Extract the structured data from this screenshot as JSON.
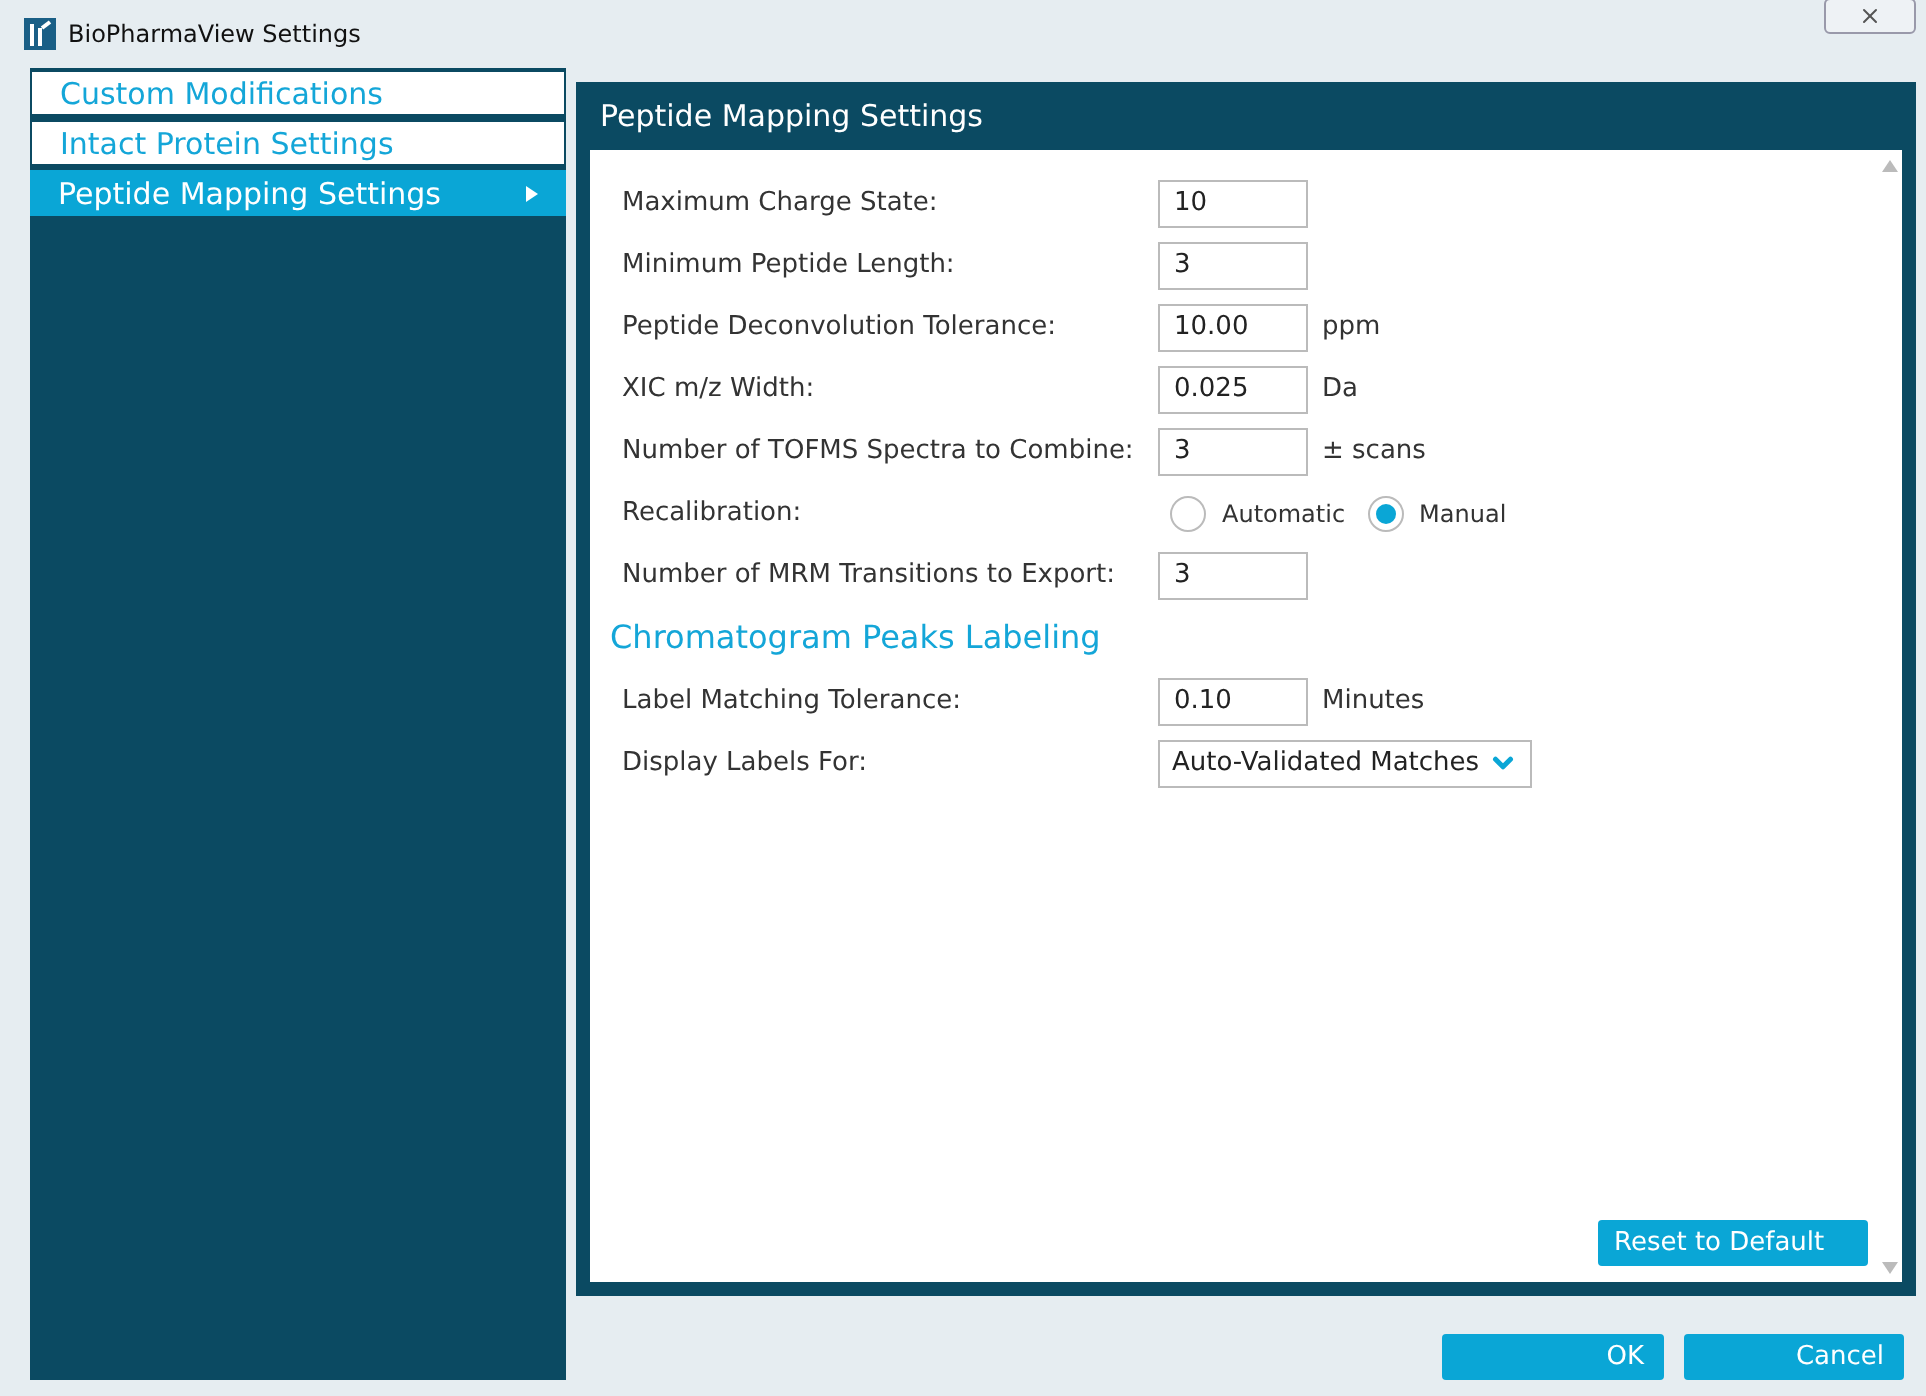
{
  "window": {
    "title": "BioPharmaView Settings"
  },
  "sidebar": {
    "items": [
      {
        "label": "Custom Modifications",
        "selected": false
      },
      {
        "label": "Intact Protein Settings",
        "selected": false
      },
      {
        "label": "Peptide Mapping Settings",
        "selected": true
      }
    ]
  },
  "panel": {
    "title": "Peptide Mapping Settings",
    "fields": [
      {
        "kind": "text",
        "label": "Maximum Charge State:",
        "value": "10"
      },
      {
        "kind": "text",
        "label": "Minimum Peptide Length:",
        "value": "3"
      },
      {
        "kind": "text",
        "label": "Peptide Deconvolution Tolerance:",
        "value": "10.00",
        "unit": "ppm"
      },
      {
        "kind": "text",
        "label": "XIC m/z Width:",
        "value": "0.025",
        "unit": "Da"
      },
      {
        "kind": "text",
        "label": "Number of TOFMS Spectra to Combine:",
        "value": "3",
        "unit": "± scans"
      },
      {
        "kind": "radio",
        "label": "Recalibration:",
        "options": [
          {
            "label": "Automatic",
            "selected": false
          },
          {
            "label": "Manual",
            "selected": true
          }
        ]
      },
      {
        "kind": "text",
        "label": "Number of MRM Transitions to Export:",
        "value": "3"
      }
    ],
    "section": {
      "heading": "Chromatogram Peaks Labeling",
      "fields": [
        {
          "kind": "text",
          "label": "Label Matching Tolerance:",
          "value": "0.10",
          "unit": "Minutes"
        },
        {
          "kind": "dropdown",
          "label": "Display Labels For:",
          "value": "Auto-Validated Matches"
        }
      ]
    },
    "reset_button": "Reset to Default"
  },
  "buttons": [
    "OK",
    "Cancel"
  ]
}
